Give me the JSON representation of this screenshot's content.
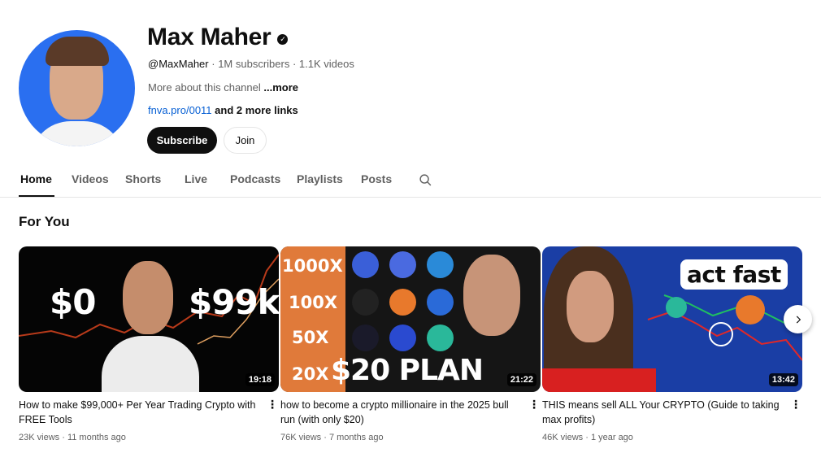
{
  "channel": {
    "name": "Max Maher",
    "handle": "@MaxMaher",
    "subscribers": "1M subscribers",
    "videos": "1.1K videos",
    "about": "More about this channel",
    "about_more": "...more",
    "link": "fnva.pro/0011",
    "more_links": "and 2 more links",
    "subscribe_label": "Subscribe",
    "join_label": "Join"
  },
  "tabs": [
    "Home",
    "Videos",
    "Shorts",
    "Live",
    "Podcasts",
    "Playlists",
    "Posts"
  ],
  "section": {
    "title": "For You"
  },
  "videos": [
    {
      "title": "How to make $99,000+ Per Year Trading Crypto with FREE Tools",
      "views": "23K views",
      "age": "11 months ago",
      "duration": "19:18",
      "thumb_text_left": "$0",
      "thumb_text_right": "$99k"
    },
    {
      "title": "how to become a crypto millionaire in the 2025 bull run (with only $20)",
      "views": "76K views",
      "age": "7 months ago",
      "duration": "21:22",
      "multipliers": [
        "1000X",
        "100X",
        "50X",
        "20X"
      ],
      "thumb_text": "$20 PLAN"
    },
    {
      "title": "THIS means sell ALL Your CRYPTO (Guide to taking max profits)",
      "views": "46K views",
      "age": "1 year ago",
      "duration": "13:42",
      "thumb_text": "act fast"
    }
  ],
  "colors": {
    "link": "#065fd4",
    "subscribe_bg": "#0f0f0f",
    "avatar_bg": "#2a6ff0"
  }
}
